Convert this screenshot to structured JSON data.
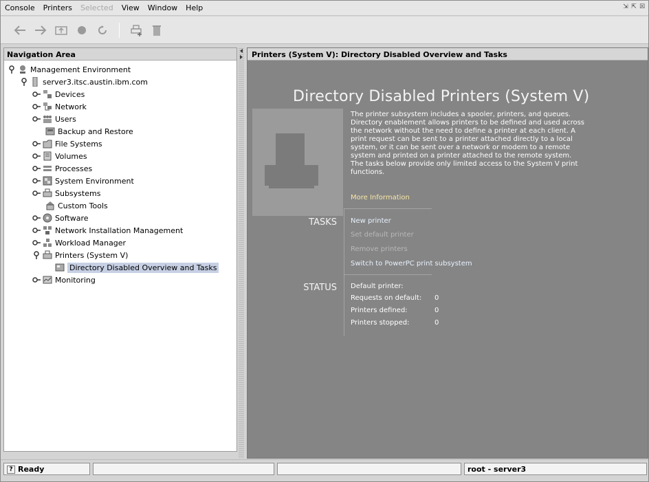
{
  "menubar": {
    "items": [
      {
        "label": "Console",
        "disabled": false
      },
      {
        "label": "Printers",
        "disabled": false
      },
      {
        "label": "Selected",
        "disabled": true
      },
      {
        "label": "View",
        "disabled": false
      },
      {
        "label": "Window",
        "disabled": false
      },
      {
        "label": "Help",
        "disabled": false
      }
    ]
  },
  "toolbar": {
    "icons": [
      "back-arrow-icon",
      "forward-arrow-icon",
      "up-folder-icon",
      "stop-icon",
      "refresh-icon",
      "new-printer-icon",
      "trash-icon"
    ]
  },
  "nav": {
    "header": "Navigation Area",
    "tree": [
      {
        "label": "Management Environment",
        "icon": "pin-icon"
      },
      {
        "label": "server3.itsc.austin.ibm.com",
        "icon": "server-icon"
      },
      {
        "label": "Devices",
        "icon": "devices-icon"
      },
      {
        "label": "Network",
        "icon": "network-icon"
      },
      {
        "label": "Users",
        "icon": "users-icon"
      },
      {
        "label": "Backup and Restore",
        "icon": "backup-icon"
      },
      {
        "label": "File Systems",
        "icon": "filesystems-icon"
      },
      {
        "label": "Volumes",
        "icon": "volumes-icon"
      },
      {
        "label": "Processes",
        "icon": "processes-icon"
      },
      {
        "label": "System Environment",
        "icon": "system-environment-icon"
      },
      {
        "label": "Subsystems",
        "icon": "subsystems-icon"
      },
      {
        "label": "Custom Tools",
        "icon": "custom-tools-icon"
      },
      {
        "label": "Software",
        "icon": "software-icon"
      },
      {
        "label": "Network Installation Management",
        "icon": "nim-icon"
      },
      {
        "label": "Workload Manager",
        "icon": "workload-manager-icon"
      },
      {
        "label": "Printers (System V)",
        "icon": "printer-icon"
      },
      {
        "label": "Directory Disabled Overview and Tasks",
        "icon": "overview-icon"
      },
      {
        "label": "Monitoring",
        "icon": "monitoring-icon"
      }
    ]
  },
  "content": {
    "header": "Printers (System V): Directory Disabled Overview and Tasks",
    "title": "Directory Disabled Printers (System V)",
    "description": "The printer subsystem includes a spooler, printers, and queues.  Directory enablement allows printers to be defined and used across the network without the need to define a printer at each client.  A print request can be sent to a printer attached directly to a local system, or it can be sent over a network or modem to a remote system and printed on a printer attached to the remote system.  The tasks below provide only limited access to the System V print functions.",
    "more_info": "More Information",
    "tasks_label": "TASKS",
    "tasks": [
      {
        "label": "New printer",
        "enabled": true
      },
      {
        "label": "Set default printer",
        "enabled": false
      },
      {
        "label": "Remove printers",
        "enabled": false
      },
      {
        "label": "Switch to PowerPC print subsystem",
        "enabled": true
      }
    ],
    "status_label": "STATUS",
    "status": [
      {
        "label": "Default printer:",
        "value": ""
      },
      {
        "label": "Requests on default:",
        "value": "0"
      },
      {
        "label": "Printers defined:",
        "value": "0"
      },
      {
        "label": "Printers stopped:",
        "value": "0"
      }
    ]
  },
  "statusbar": {
    "ready": "Ready",
    "user": "root - server3"
  }
}
